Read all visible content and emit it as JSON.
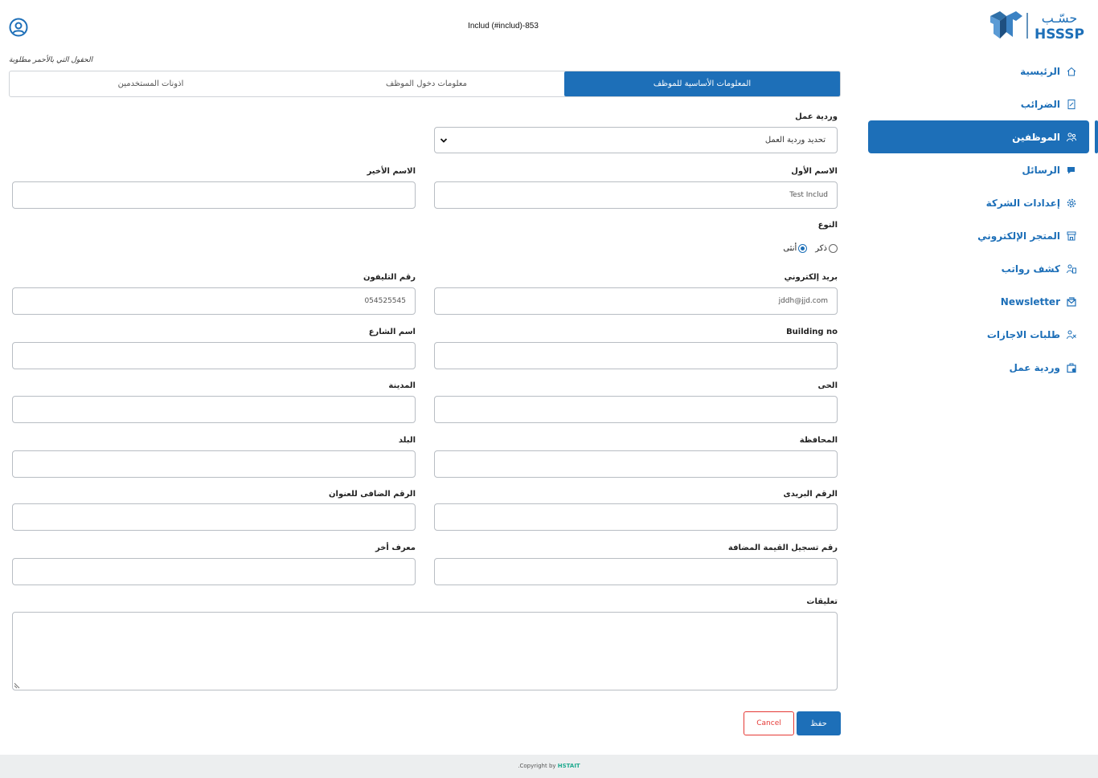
{
  "header": {
    "title": "Includ (#includ)-853"
  },
  "sidebar": {
    "items": [
      {
        "label": "الرئيسية",
        "icon": "home-icon"
      },
      {
        "label": "الضرائب",
        "icon": "tax-icon"
      },
      {
        "label": "الموظفين",
        "icon": "employees-icon",
        "active": true
      },
      {
        "label": "الرسائل",
        "icon": "messages-icon"
      },
      {
        "label": "إعدادات الشركة",
        "icon": "gear-icon"
      },
      {
        "label": "المتجر الإلكتروني",
        "icon": "store-icon"
      },
      {
        "label": "كشف رواتب",
        "icon": "payroll-icon"
      },
      {
        "label": "Newsletter",
        "icon": "newsletter-icon"
      },
      {
        "label": "طلبات الاجازات",
        "icon": "vacation-icon"
      },
      {
        "label": "وردية عمل",
        "icon": "shift-icon"
      }
    ]
  },
  "form": {
    "required_note": "الحقول التي بالأحمر مطلوبة",
    "tabs": [
      {
        "label": "المعلومات الأساسية للموظف",
        "active": true
      },
      {
        "label": "معلومات دخول الموظف"
      },
      {
        "label": "اذونات المستخدمين"
      }
    ],
    "shift": {
      "label": "وردية عمل",
      "value": "تحديد وردية العمل"
    },
    "first_name": {
      "label": "الاسم الأول",
      "value": "Test Includ"
    },
    "last_name": {
      "label": "الاسم الأخير",
      "value": ""
    },
    "gender": {
      "label": "النوع",
      "options": [
        "ذكر",
        "أنثى"
      ],
      "selected": "أنثى"
    },
    "email": {
      "label": "بريد إلكتروني",
      "value": "jddh@jjd.com"
    },
    "phone": {
      "label": "رقم التليفون",
      "value": "054525545"
    },
    "building_no": {
      "label": "Building no",
      "value": ""
    },
    "street": {
      "label": "اسم الشارع",
      "value": ""
    },
    "district": {
      "label": "الحى",
      "value": ""
    },
    "city": {
      "label": "المدينة",
      "value": ""
    },
    "province": {
      "label": "المحافظة",
      "value": ""
    },
    "country": {
      "label": "البلد",
      "value": ""
    },
    "postal_code": {
      "label": "الرقم البريدى",
      "value": ""
    },
    "additional_no": {
      "label": "الرقم الضافى للعنوان",
      "value": ""
    },
    "vat_no": {
      "label": "رقم تسجيل القيمة المضافة",
      "value": ""
    },
    "other_id": {
      "label": "معرف أخر",
      "value": ""
    },
    "comments": {
      "label": "تعليقات",
      "value": ""
    },
    "cancel_label": "Cancel",
    "save_label": "حفظ"
  },
  "footer": {
    "text": "Copyright by",
    "brand": "HSTAIT",
    "dot": "."
  },
  "colors": {
    "primary": "#1d6fb8",
    "danger": "#e53935",
    "brand_green": "#1faa8f"
  }
}
